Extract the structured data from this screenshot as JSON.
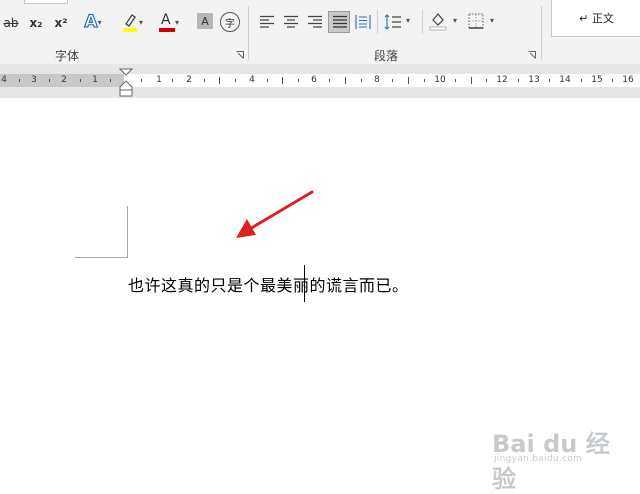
{
  "ribbon": {
    "font_group_label": "字体",
    "paragraph_group_label": "段落",
    "strikethrough_label": "ab",
    "subscript_label": "x₂",
    "superscript_label": "x²",
    "text_effects_label": "A",
    "font_color_label": "A",
    "char_shading_label": "A",
    "enclose_char_label": "字",
    "style_normal_label": "↵ 正文",
    "highlight_color": "#ffff00",
    "font_color": "#d00000"
  },
  "ruler": {
    "left_numbers": [
      "4",
      "3",
      "2",
      "1"
    ],
    "right_numbers": [
      "1",
      "2",
      "4",
      "6",
      "8",
      "10",
      "12",
      "13",
      "14",
      "15",
      "16"
    ]
  },
  "document": {
    "text": "也许这真的只是个最美丽的谎言而已。"
  },
  "watermark": {
    "brand": "Bai du 经验",
    "url": "jingyan.baidu.com"
  }
}
